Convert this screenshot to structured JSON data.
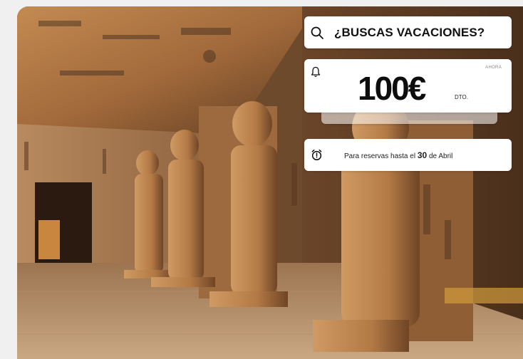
{
  "search": {
    "label": "¿BUSCAS VACACIONES?",
    "icon": "search-icon"
  },
  "offer": {
    "badge": "AHORA",
    "amount": "100€",
    "suffix": "DTO.",
    "icon": "bell-icon"
  },
  "info": {
    "prefix": "Para reservas hasta el",
    "day": "30",
    "suffix": "de Abril",
    "icon": "alarm-clock-icon"
  },
  "colors": {
    "card_bg": "#ffffff",
    "text": "#111111",
    "stone": "#b9824d",
    "shadow": "#3a2414"
  }
}
